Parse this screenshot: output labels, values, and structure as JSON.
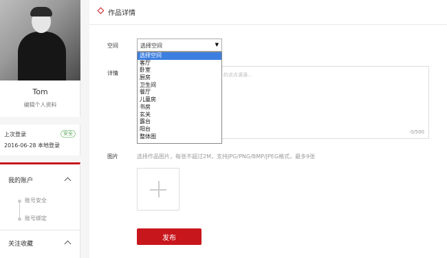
{
  "profile": {
    "username": "Tom",
    "edit_link": "编辑个人资料"
  },
  "login": {
    "label": "上次登录",
    "badge": "安全",
    "info": "2016-06-28 本地登录"
  },
  "menu": {
    "accent_color": "#c8161d",
    "sections": [
      {
        "label": "我的账户",
        "items": [
          "账号安全",
          "账号绑定"
        ]
      },
      {
        "label": "关注收藏"
      }
    ]
  },
  "main": {
    "title": "作品详情",
    "space_label": "空间",
    "detail_label": "详情",
    "image_label": "图片",
    "select_value": "选择空间",
    "dropdown_options": [
      "选择空间",
      "客厅",
      "卧室",
      "厨房",
      "卫生间",
      "餐厅",
      "儿童房",
      "书房",
      "玄关",
      "露台",
      "阳台",
      "整体图"
    ],
    "detail_placeholder": "的点点滴滴...",
    "char_count": "0/500",
    "image_hint": "选择作品图片，每张不超过2M，支持JPG/PNG/BMP/JPEG格式，最多9张",
    "publish_label": "发布"
  }
}
